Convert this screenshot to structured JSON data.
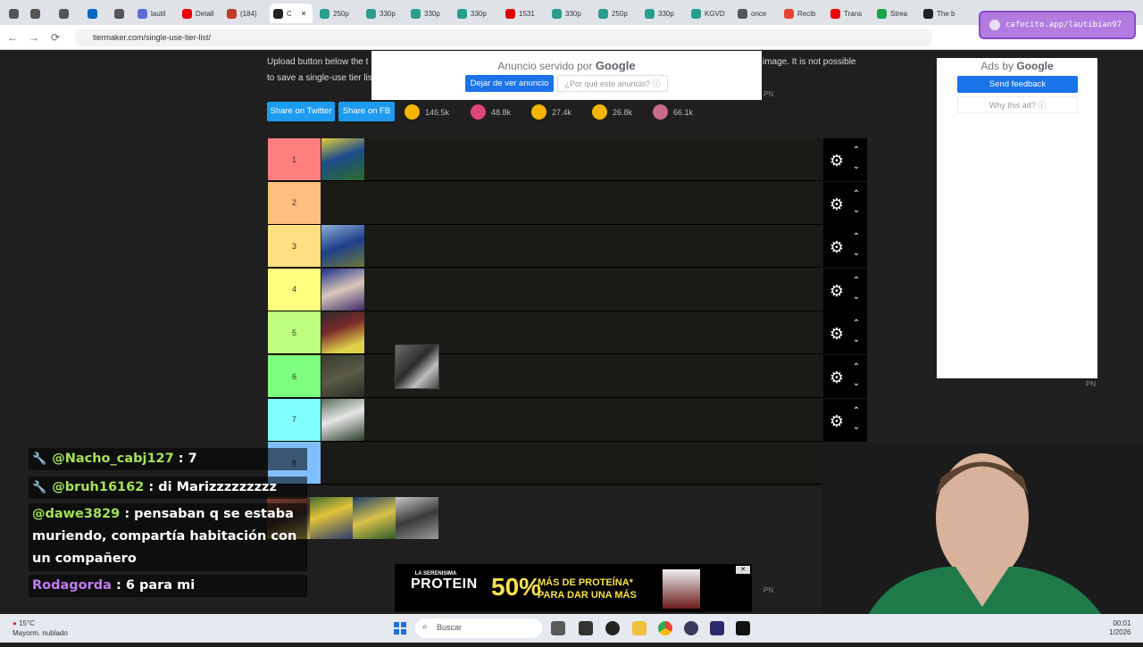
{
  "browser": {
    "tabs": [
      {
        "label": "",
        "color": "#555"
      },
      {
        "label": "",
        "color": "#555"
      },
      {
        "label": "",
        "color": "#555"
      },
      {
        "label": "",
        "color": "#0a66c2"
      },
      {
        "label": "",
        "color": "#555"
      },
      {
        "label": "lautil",
        "color": "#5f6ad8"
      },
      {
        "label": "Detall",
        "color": "#e00"
      },
      {
        "label": "(184)",
        "color": "#c0392b"
      },
      {
        "label": "C",
        "color": "#222"
      },
      {
        "label": "250p",
        "color": "#2a9d8f"
      },
      {
        "label": "330p",
        "color": "#2a9d8f"
      },
      {
        "label": "330p",
        "color": "#2a9d8f"
      },
      {
        "label": "330p",
        "color": "#2a9d8f"
      },
      {
        "label": "1531",
        "color": "#d00"
      },
      {
        "label": "330p",
        "color": "#2a9d8f"
      },
      {
        "label": "250p",
        "color": "#2a9d8f"
      },
      {
        "label": "330p",
        "color": "#2a9d8f"
      },
      {
        "label": "KGVD",
        "color": "#2a9d8f"
      },
      {
        "label": "once",
        "color": "#555"
      },
      {
        "label": "Recib",
        "color": "#ea4335"
      },
      {
        "label": "Trans",
        "color": "#e00"
      },
      {
        "label": "Strea",
        "color": "#16a34a"
      },
      {
        "label": "The b",
        "color": "#222"
      }
    ],
    "url": "tiermaker.com/single-use-tier-list/",
    "extension": "cafecito.app/lautibian97"
  },
  "page": {
    "intro_line1": "Upload button below the t",
    "intro_line1_end": "t image. It is not possible",
    "intro_line2": "to save a single-use tier lis",
    "share_twitter": "Share on Twitter",
    "share_fb": "Share on FB",
    "reactions": [
      {
        "count": "146.5k",
        "color": "#f4b400"
      },
      {
        "count": "48.8k",
        "color": "#e0457b"
      },
      {
        "count": "27.4k",
        "color": "#f4b400"
      },
      {
        "count": "26.8k",
        "color": "#f4b400"
      },
      {
        "count": "66.1k",
        "color": "#c76b8a"
      }
    ]
  },
  "ads": {
    "top_title": "Anuncio servido por",
    "top_brand": "Google",
    "top_stop": "Dejar de ver anuncio",
    "top_why": "¿Por qué este anuncio? ⓘ",
    "pn": "PN",
    "side_title": "Ads by",
    "side_brand": "Google",
    "side_feedback": "Send feedback",
    "side_why": "Why this ad? ⓘ",
    "bottom_brand": "LA SERENISIMA",
    "bottom_product": "PROTEIN",
    "bottom_pct": "50%",
    "bottom_line1": "MÁS DE PROTEÍNA*",
    "bottom_line2": "PARA DAR UNA MÁS"
  },
  "tiers": [
    {
      "label": "1",
      "color": "#ff7f7f"
    },
    {
      "label": "2",
      "color": "#ffbf7f"
    },
    {
      "label": "3",
      "color": "#ffdf7f"
    },
    {
      "label": "4",
      "color": "#ffff7f"
    },
    {
      "label": "5",
      "color": "#bfff7f"
    },
    {
      "label": "6",
      "color": "#7fff7f"
    },
    {
      "label": "7",
      "color": "#7fffff"
    },
    {
      "label": "8",
      "color": "#7fbfff"
    }
  ],
  "controls": {
    "gear": "⚙",
    "up": "⌃",
    "down": "⌄"
  },
  "chat": [
    {
      "user": "@Nacho_cabj127",
      "user_color": "#a3e05a",
      "text": " : 7",
      "mod": true
    },
    {
      "user": "@bruh16162",
      "user_color": "#a3e05a",
      "text": " : di Marizzzzzzzzz",
      "mod": true
    },
    {
      "user": "@dawe3829",
      "user_color": "#a3e05a",
      "text": " : pensaban q se estaba muriendo, compartía habitación con un compañero",
      "mod": false
    },
    {
      "user": "Rodagorda",
      "user_color": "#c07cf0",
      "text": " : 6 para mi",
      "mod": false
    }
  ],
  "taskbar": {
    "temp": "15°C",
    "weather": "Mayorm. nublado",
    "search": "Buscar",
    "time": "00:01",
    "date": "1/2026"
  }
}
